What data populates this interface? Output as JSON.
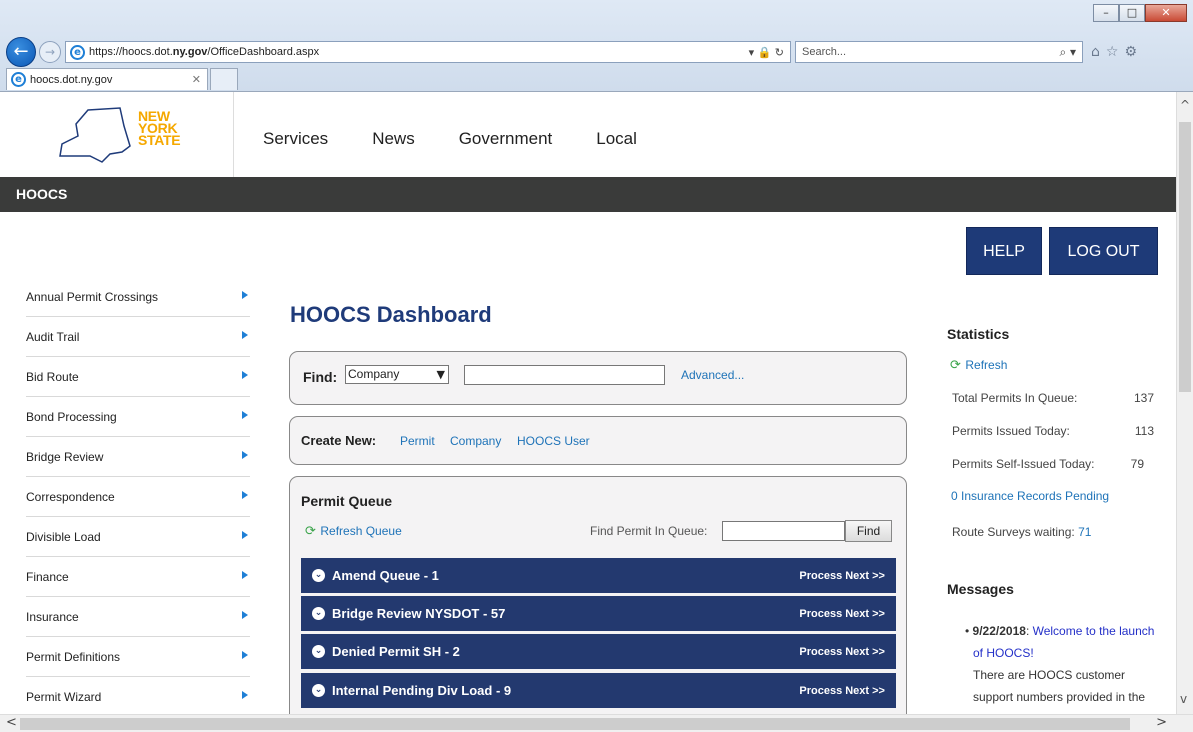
{
  "browser": {
    "url_prefix": "https://hoocs.dot.",
    "url_bold": "ny.gov",
    "url_suffix": "/OfficeDashboard.aspx",
    "search_placeholder": "Search...",
    "tab_title": "hoocs.dot.ny.gov",
    "addr_tools": "▾ 🔒 ↻",
    "search_glyph": "⌕ ▾"
  },
  "site": {
    "logo_line1": "NEW",
    "logo_line2": "YORK",
    "logo_line3": "STATE",
    "nav": [
      "Services",
      "News",
      "Government",
      "Local"
    ],
    "section_bar": "HOOCS",
    "help_label": "HELP",
    "logout_label": "LOG OUT"
  },
  "sidebar": {
    "items": [
      "Annual Permit Crossings",
      "Audit Trail",
      "Bid Route",
      "Bond Processing",
      "Bridge Review",
      "Correspondence",
      "Divisible Load",
      "Finance",
      "Insurance",
      "Permit Definitions",
      "Permit Wizard"
    ]
  },
  "dashboard": {
    "title": "HOOCS Dashboard",
    "find_label": "Find:",
    "find_select_value": "Company",
    "advanced_link": "Advanced...",
    "create_label": "Create New:",
    "create_links": [
      "Permit",
      "Company",
      "HOOCS User"
    ],
    "queue_title": "Permit Queue",
    "refresh_queue": "Refresh Queue",
    "find_in_queue_label": "Find Permit In Queue:",
    "find_button": "Find",
    "queues": [
      {
        "name": "Amend Queue - 1",
        "action": "Process Next >>"
      },
      {
        "name": "Bridge Review NYSDOT - 57",
        "action": "Process Next >>"
      },
      {
        "name": "Denied Permit SH - 2",
        "action": "Process Next >>"
      },
      {
        "name": "Internal Pending Div Load - 9",
        "action": "Process Next >>"
      }
    ]
  },
  "statistics": {
    "heading": "Statistics",
    "refresh": "Refresh",
    "rows": [
      {
        "label": "Total Permits In Queue:",
        "value": "137"
      },
      {
        "label": "Permits Issued Today:",
        "value": "113"
      },
      {
        "label": "Permits Self-Issued Today:",
        "value": "79"
      }
    ],
    "insurance_pending": "0 Insurance Records Pending",
    "route_surveys_label": "Route Surveys waiting:",
    "route_surveys_value": "71"
  },
  "messages": {
    "heading": "Messages",
    "date": "9/22/2018",
    "link_text_1": "Welcome to the launch",
    "link_text_2": "of HOOCS!",
    "body_1": "There are HOOCS customer",
    "body_2": "support numbers provided in the"
  },
  "colors": {
    "brand_blue": "#1f3b7a",
    "queue_bar": "#23396f",
    "link_blue": "#1e73b8",
    "logo_gold": "#f5a800"
  }
}
